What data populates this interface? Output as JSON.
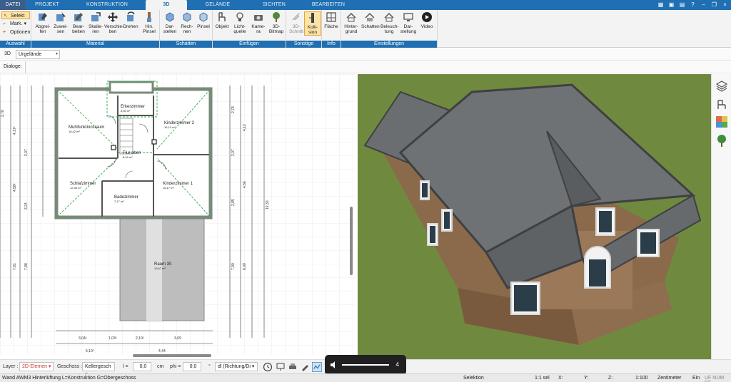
{
  "tabs": [
    "DATEI",
    "PROJEKT",
    "KONSTRUKTION",
    "3D",
    "GELÄNDE",
    "SICHTEN",
    "BEARBEITEN"
  ],
  "ribbon": {
    "auswahl": {
      "label": "Auswahl",
      "selekt": "Selekt",
      "mark": "Mark.",
      "optionen": "Optionen"
    },
    "material": {
      "label": "Material",
      "buttons": [
        "Abgrei-\nfen",
        "Zuwei-\nsen",
        "Bear-\nbeiten",
        "Skalie-\nren",
        "Verschie-\nben",
        "Drehen",
        "Hin.\nPinsel"
      ]
    },
    "schatten": {
      "label": "Schatten",
      "buttons": [
        "Dar-\nstellen",
        "Rech-\nnen",
        "Pinsel"
      ]
    },
    "einfuegen": {
      "label": "Einfügen",
      "buttons": [
        "Objekt",
        "Licht-\nquelle",
        "Kame-\nra",
        "3D-\nBitmap"
      ]
    },
    "sonstige": {
      "label": "Sonstige",
      "buttons": [
        "3D-\nSchnitt",
        "Kolli-\nsion"
      ]
    },
    "info": {
      "label": "Info",
      "buttons": [
        "Fläche"
      ]
    },
    "einstellungen": {
      "label": "Einstellungen",
      "buttons": [
        "Hinter-\ngrund",
        "Schatten",
        "Beleuch-\ntung",
        "Dar-\nstellung",
        "Video"
      ]
    }
  },
  "layerrow": {
    "view": "3D",
    "terrain": "Urgelände"
  },
  "dialoge": "Dialoge:",
  "plan": {
    "rooms": [
      {
        "name": "Erkerzimmer",
        "area": "8,05 m²"
      },
      {
        "name": "Multifunktionsraum",
        "area": "18,42 m²"
      },
      {
        "name": "Kinderzimmer 2",
        "area": "16,10 m²"
      },
      {
        "name": "Flur oben",
        "area": "8,34 m²"
      },
      {
        "name": "Schlafzimmer",
        "area": "12,38 m²"
      },
      {
        "name": "Badezimmer",
        "area": "7,17 m²"
      },
      {
        "name": "Kinderzimmer 1",
        "area": "16,17 m²"
      },
      {
        "name": "Raum 30",
        "area": "10,67 m²"
      }
    ],
    "dims_bottom": [
      "3,04²",
      "1,03²",
      "2,10²",
      "3,69",
      "5,10²",
      "4,44"
    ],
    "dims_left": [
      "2,78",
      "4,17²",
      "2,07",
      "4,58²",
      "3,24",
      "7,61",
      "7,88"
    ],
    "dims_right": [
      "2,78",
      "4,12",
      "2,07",
      "4,56",
      "2,85",
      "7,90",
      "8,00",
      "19,30"
    ]
  },
  "toolstrip": {
    "layer_label": "Layer :",
    "layer_value": "2D-Elemen",
    "geschoss_label": "Geschoss :",
    "geschoss_value": "Kellergesch",
    "l_label": "l =",
    "l_value": "0,0",
    "cm": "cm",
    "phi_label": "phi =",
    "phi_value": "0,0",
    "deg": "°",
    "richtung": "dl (Richtung/Di"
  },
  "volume": {
    "level": "4"
  },
  "statusbar": {
    "message": "Wand AWM3 Hinterlüftung L=Konstruktion G=Obergeschoss",
    "mode": "Selektion",
    "scale": "1:1 sel",
    "x": "X:",
    "y": "Y:",
    "z": "Z:",
    "ratio": "1:100",
    "unit": "Zentimeter",
    "ein": "Ein",
    "flags": "UF NUM RF"
  },
  "colors": {
    "accent": "#1f6fb2",
    "grass": "#6f8a3e",
    "roof": "#6b6e70",
    "brick": "#8a6a4a",
    "highlight": "#fce3a8"
  }
}
